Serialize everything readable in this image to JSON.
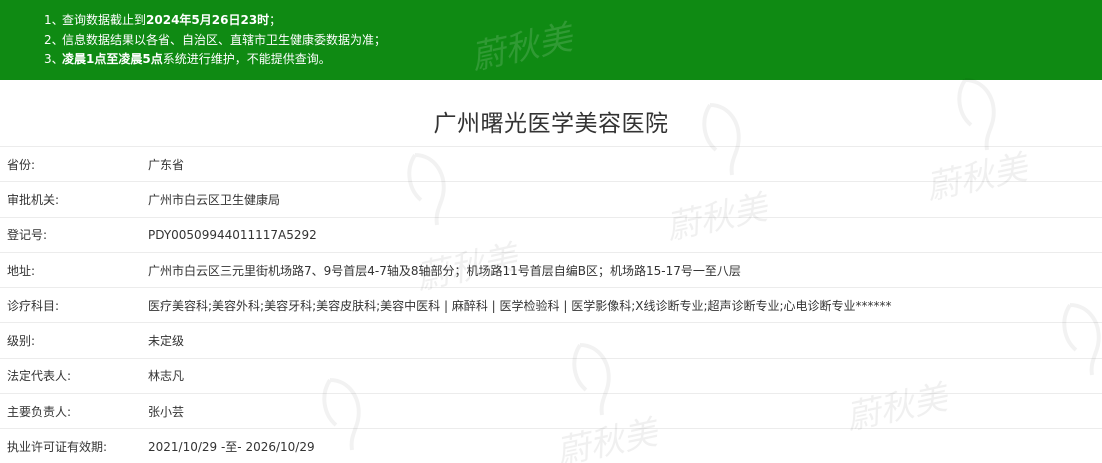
{
  "notice": {
    "items": [
      {
        "num": "1、",
        "pre": "查询数据截止到",
        "bold": "2024年5月26日23时",
        "post": "；"
      },
      {
        "num": "2、",
        "pre": "信息数据结果以各省、自治区、直辖市卫生健康委数据为准；",
        "bold": "",
        "post": ""
      },
      {
        "num": "3、",
        "pre": "",
        "bold": "凌晨1点至凌晨5点",
        "post": "系统进行维护，不能提供查询。"
      }
    ]
  },
  "hospital": {
    "name": "广州曙光医学美容医院"
  },
  "fields": [
    {
      "label": "省份:",
      "value": "广东省"
    },
    {
      "label": "审批机关:",
      "value": "广州市白云区卫生健康局"
    },
    {
      "label": "登记号:",
      "value": "PDY00509944011117A5292"
    },
    {
      "label": "地址:",
      "value": "广州市白云区三元里街机场路7、9号首层4-7轴及8轴部分；机场路11号首层自编B区；机场路15-17号一至八层"
    },
    {
      "label": "诊疗科目:",
      "value": "医疗美容科;美容外科;美容牙科;美容皮肤科;美容中医科 | 麻醉科 | 医学检验科 | 医学影像科;X线诊断专业;超声诊断专业;心电诊断专业******"
    },
    {
      "label": "级别:",
      "value": "未定级"
    },
    {
      "label": "法定代表人:",
      "value": "林志凡"
    },
    {
      "label": "主要负责人:",
      "value": "张小芸"
    },
    {
      "label": "执业许可证有效期:",
      "value": "2021/10/29 -至- 2026/10/29"
    }
  ],
  "watermark": {
    "text": "蔚秋美"
  },
  "colors": {
    "banner": "#0f8a13",
    "text": "#333333",
    "divider": "#ececec"
  }
}
